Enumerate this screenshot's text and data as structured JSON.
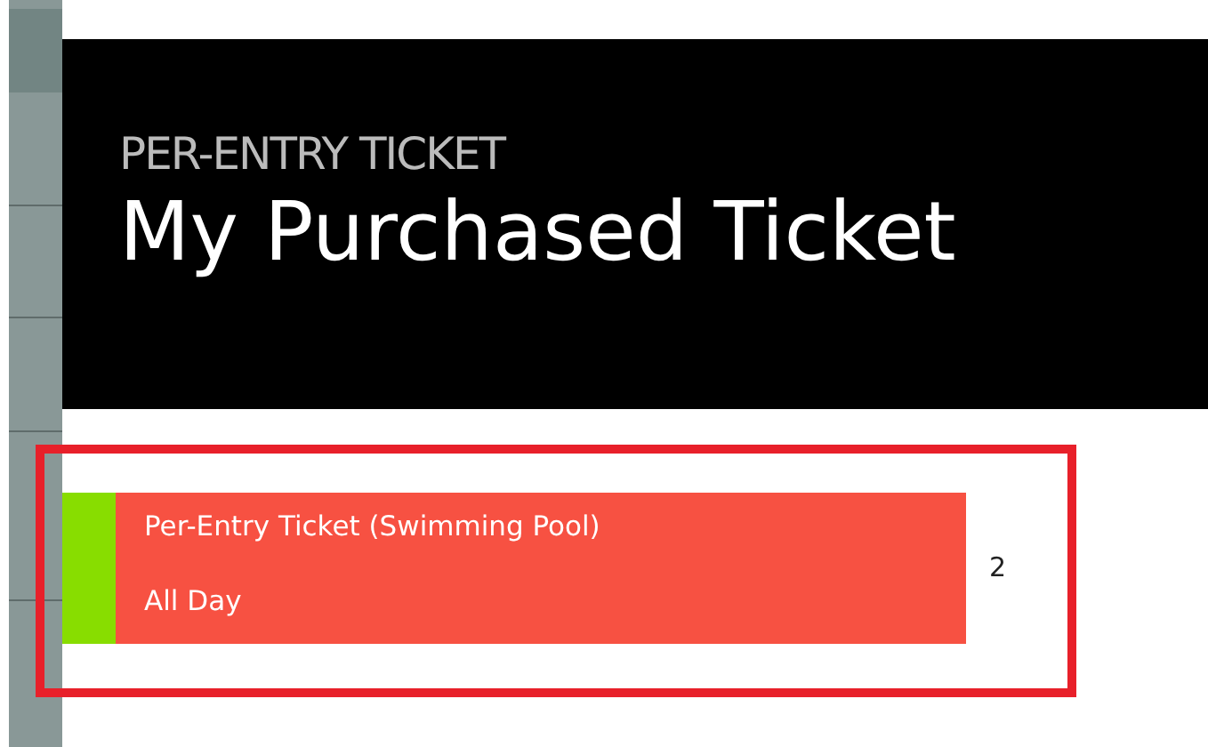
{
  "header": {
    "subtitle": "PER-ENTRY TICKET",
    "title": "My Purchased Ticket"
  },
  "tickets": [
    {
      "name": "Per-Entry Ticket (Swimming Pool)",
      "time": "All Day",
      "quantity": "2",
      "color": "#88dd00"
    }
  ]
}
